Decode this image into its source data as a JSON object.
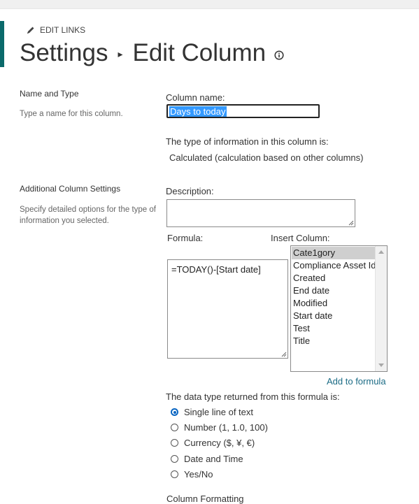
{
  "header": {
    "edit_links": "EDIT LINKS",
    "breadcrumb_root": "Settings",
    "breadcrumb_sep": "▸",
    "page_title": "Edit Column"
  },
  "name_and_type": {
    "title": "Name and Type",
    "description": "Type a name for this column.",
    "column_name_label": "Column name:",
    "column_name_value": "Days to today",
    "type_info_label": "The type of information in this column is:",
    "type_info_value": "Calculated (calculation based on other columns)"
  },
  "additional": {
    "title": "Additional Column Settings",
    "description": "Specify detailed options for the type of information you selected.",
    "description_label": "Description:",
    "description_value": "",
    "formula_label": "Formula:",
    "formula_value": "=TODAY()-[Start date]",
    "insert_column_label": "Insert Column:",
    "insert_columns": [
      "Cate1gory",
      "Compliance Asset Id",
      "Created",
      "End date",
      "Modified",
      "Start date",
      "Test",
      "Title"
    ],
    "selected_insert_column": "Cate1gory",
    "add_to_formula": "Add to formula",
    "data_type_label": "The data type returned from this formula is:",
    "data_types": [
      "Single line of text",
      "Number (1, 1.0, 100)",
      "Currency ($, ¥, €)",
      "Date and Time",
      "Yes/No"
    ],
    "selected_data_type": "Single line of text",
    "next_section_label": "Column Formatting"
  },
  "colors": {
    "accent": "#0b6a6b",
    "link": "#1b6b85",
    "selection": "#3399ff",
    "radio_checked": "#0a66c2"
  },
  "icons": {
    "edit": "pencil-icon",
    "info": "info-icon"
  }
}
